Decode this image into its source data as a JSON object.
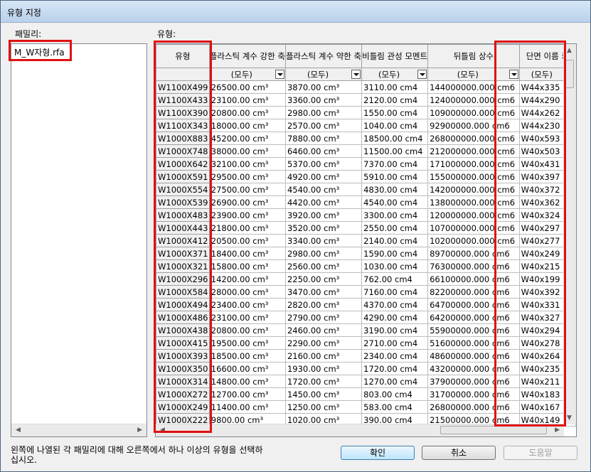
{
  "window": {
    "title": "유형 지정"
  },
  "labels": {
    "family": "패밀리:",
    "types": "유형:"
  },
  "family": {
    "selected": "M_W자형.rfa"
  },
  "grid": {
    "columns": [
      "유형",
      "플라스틱 계수 강한 축",
      "플라스틱 계수 약한 축",
      "비틀림 관성 모멘트",
      "뒤틀림 상수",
      "단면 이름 키"
    ],
    "filter": "(모두)",
    "rows": [
      [
        "W1100X499",
        "26500.00 cm³",
        "3870.00 cm³",
        "3110.00 cm4",
        "144000000.000 cm6",
        "W44x335"
      ],
      [
        "W1100X433",
        "23100.00 cm³",
        "3360.00 cm³",
        "2120.00 cm4",
        "124000000.000 cm6",
        "W44x290"
      ],
      [
        "W1100X390",
        "20800.00 cm³",
        "2980.00 cm³",
        "1550.00 cm4",
        "109000000.000 cm6",
        "W44x262"
      ],
      [
        "W1100X343",
        "18000.00 cm³",
        "2570.00 cm³",
        "1040.00 cm4",
        "92900000.000 cm6",
        "W44x230"
      ],
      [
        "W1000X883",
        "45200.00 cm³",
        "7880.00 cm³",
        "18500.00 cm4",
        "268000000.000 cm6",
        "W40x593"
      ],
      [
        "W1000X748",
        "38000.00 cm³",
        "6460.00 cm³",
        "11500.00 cm4",
        "212000000.000 cm6",
        "W40x503"
      ],
      [
        "W1000X642",
        "32100.00 cm³",
        "5370.00 cm³",
        "7370.00 cm4",
        "171000000.000 cm6",
        "W40x431"
      ],
      [
        "W1000X591",
        "29500.00 cm³",
        "4920.00 cm³",
        "5910.00 cm4",
        "155000000.000 cm6",
        "W40x397"
      ],
      [
        "W1000X554",
        "27500.00 cm³",
        "4540.00 cm³",
        "4830.00 cm4",
        "142000000.000 cm6",
        "W40x372"
      ],
      [
        "W1000X539",
        "26900.00 cm³",
        "4420.00 cm³",
        "4540.00 cm4",
        "138000000.000 cm6",
        "W40x362"
      ],
      [
        "W1000X483",
        "23900.00 cm³",
        "3920.00 cm³",
        "3300.00 cm4",
        "120000000.000 cm6",
        "W40x324"
      ],
      [
        "W1000X443",
        "21800.00 cm³",
        "3520.00 cm³",
        "2550.00 cm4",
        "107000000.000 cm6",
        "W40x297"
      ],
      [
        "W1000X412",
        "20500.00 cm³",
        "3340.00 cm³",
        "2140.00 cm4",
        "102000000.000 cm6",
        "W40x277"
      ],
      [
        "W1000X371",
        "18400.00 cm³",
        "2980.00 cm³",
        "1590.00 cm4",
        "89700000.000 cm6",
        "W40x249"
      ],
      [
        "W1000X321",
        "15800.00 cm³",
        "2560.00 cm³",
        "1030.00 cm4",
        "76300000.000 cm6",
        "W40x215"
      ],
      [
        "W1000X296",
        "14200.00 cm³",
        "2250.00 cm³",
        "762.00 cm4",
        "66100000.000 cm6",
        "W40x199"
      ],
      [
        "W1000X584",
        "28000.00 cm³",
        "3470.00 cm³",
        "7160.00 cm4",
        "82200000.000 cm6",
        "W40x392"
      ],
      [
        "W1000X494",
        "23400.00 cm³",
        "2820.00 cm³",
        "4370.00 cm4",
        "64700000.000 cm6",
        "W40x331"
      ],
      [
        "W1000X486",
        "23100.00 cm³",
        "2790.00 cm³",
        "4290.00 cm4",
        "64200000.000 cm6",
        "W40x327"
      ],
      [
        "W1000X438",
        "20800.00 cm³",
        "2460.00 cm³",
        "3190.00 cm4",
        "55900000.000 cm6",
        "W40x294"
      ],
      [
        "W1000X415",
        "19500.00 cm³",
        "2290.00 cm³",
        "2710.00 cm4",
        "51600000.000 cm6",
        "W40x278"
      ],
      [
        "W1000X393",
        "18500.00 cm³",
        "2160.00 cm³",
        "2340.00 cm4",
        "48600000.000 cm6",
        "W40x264"
      ],
      [
        "W1000X350",
        "16600.00 cm³",
        "1930.00 cm³",
        "1720.00 cm4",
        "43200000.000 cm6",
        "W40x235"
      ],
      [
        "W1000X314",
        "14800.00 cm³",
        "1720.00 cm³",
        "1270.00 cm4",
        "37900000.000 cm6",
        "W40x211"
      ],
      [
        "W1000X272",
        "12700.00 cm³",
        "1450.00 cm³",
        "803.00 cm4",
        "31700000.000 cm6",
        "W40x183"
      ],
      [
        "W1000X249",
        "11400.00 cm³",
        "1250.00 cm³",
        "583.00 cm4",
        "26800000.000 cm6",
        "W40x167"
      ],
      [
        "W1000X222",
        "9800.00 cm³",
        "1020.00 cm³",
        "390.00 cm4",
        "21500000.000 cm6",
        "W40x149"
      ]
    ]
  },
  "footer": {
    "hint": "왼쪽에 나열된 각 패밀리에 대해 오른쪽에서 하나 이상의 유형을 선택하십시오.",
    "ok": "확인",
    "cancel": "취소",
    "help": "도움말"
  },
  "colors": {
    "highlight_box": "#e01010"
  }
}
